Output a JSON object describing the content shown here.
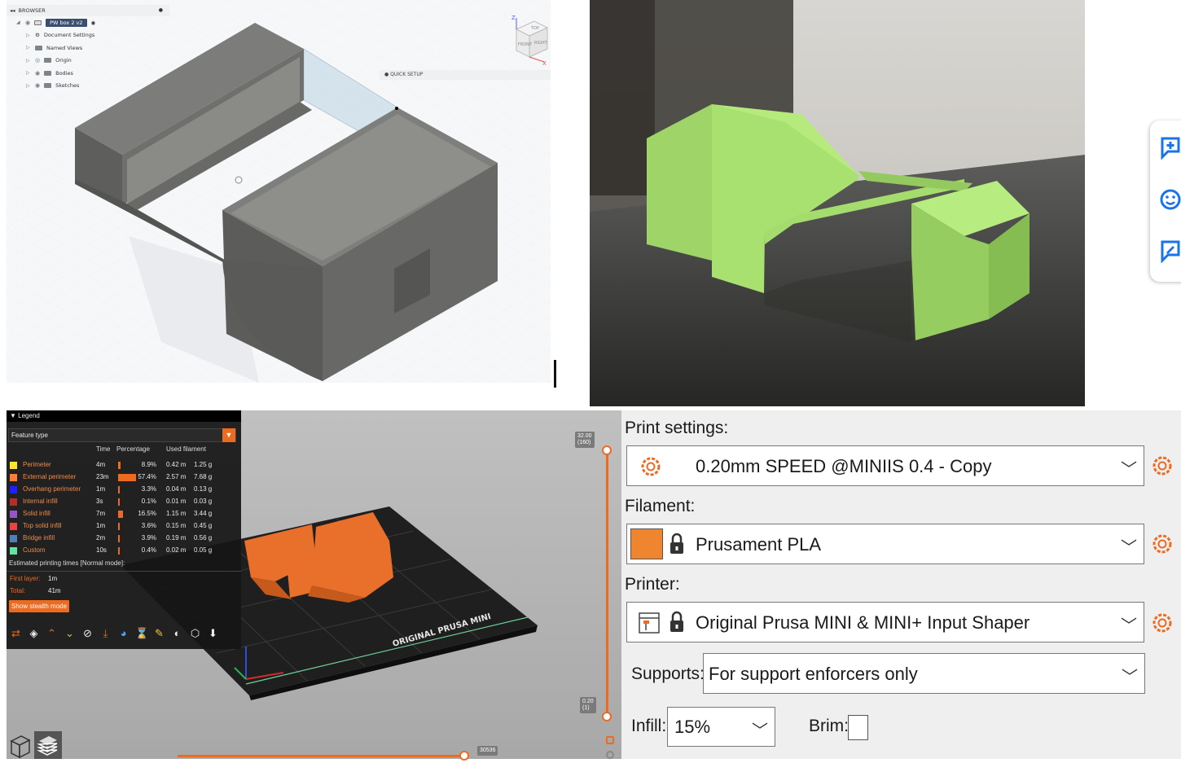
{
  "cad": {
    "browser_label": "BROWSER",
    "tree": [
      {
        "label": "PW box 2 v2"
      },
      {
        "label": "Document Settings"
      },
      {
        "label": "Named Views"
      },
      {
        "label": "Origin"
      },
      {
        "label": "Bodies"
      },
      {
        "label": "Sketches"
      }
    ],
    "quick_setup_label": "QUICK SETUP",
    "viewcube": {
      "face_top": "TOP",
      "face_front": "FRONT",
      "face_right": "RIGHT",
      "axis_z": "Z",
      "axis_x": "X"
    },
    "body_color": "#6e6e6c"
  },
  "photo": {
    "print_color": "#a5e06a"
  },
  "slicer": {
    "legend": {
      "title": "Legend",
      "feature_type": "Feature type",
      "headers": {
        "time": "Time",
        "percentage": "Percentage",
        "used_filament": "Used filament"
      },
      "rows": [
        {
          "name": "Perimeter",
          "color": "#ffe52d",
          "time": "4m",
          "pct": "8.9%",
          "pct_value": 8.9,
          "m": "0.42 m",
          "g": "1.25 g"
        },
        {
          "name": "External perimeter",
          "color": "#ff7d38",
          "time": "23m",
          "pct": "57.4%",
          "pct_value": 57.4,
          "m": "2.57 m",
          "g": "7.68 g"
        },
        {
          "name": "Overhang perimeter",
          "color": "#1f1fff",
          "time": "1m",
          "pct": "3.3%",
          "pct_value": 3.3,
          "m": "0.04 m",
          "g": "0.13 g"
        },
        {
          "name": "Internal infill",
          "color": "#b03029",
          "time": "3s",
          "pct": "0.1%",
          "pct_value": 0.1,
          "m": "0.01 m",
          "g": "0.03 g"
        },
        {
          "name": "Solid infill",
          "color": "#9654cc",
          "time": "7m",
          "pct": "16.5%",
          "pct_value": 16.5,
          "m": "1.15 m",
          "g": "3.44 g"
        },
        {
          "name": "Top solid infill",
          "color": "#f04040",
          "time": "1m",
          "pct": "3.6%",
          "pct_value": 3.6,
          "m": "0.15 m",
          "g": "0.45 g"
        },
        {
          "name": "Bridge infill",
          "color": "#4d80ba",
          "time": "2m",
          "pct": "3.9%",
          "pct_value": 3.9,
          "m": "0.19 m",
          "g": "0.56 g"
        },
        {
          "name": "Custom",
          "color": "#5ee6a0",
          "time": "10s",
          "pct": "0.4%",
          "pct_value": 0.4,
          "m": "0.02 m",
          "g": "0.05 g"
        }
      ],
      "estimated_label": "Estimated printing times [Normal mode]:",
      "first_layer_label": "First layer:",
      "first_layer_value": "1m",
      "total_label": "Total:",
      "total_value": "41m",
      "stealth_button": "Show stealth mode"
    },
    "bed_label": "ORIGINAL PRUSA MINI",
    "layer_top": {
      "height": "32.00",
      "index": "(160)"
    },
    "layer_bottom": {
      "height": "0.20",
      "index": "(1)"
    },
    "horizontal_value": "30536",
    "accent": "#ed6b21"
  },
  "settings": {
    "print_settings_label": "Print settings:",
    "print_profile": "0.20mm SPEED @MINIIS 0.4 - Copy",
    "filament_label": "Filament:",
    "filament": "Prusament PLA",
    "filament_color": "#f08530",
    "printer_label": "Printer:",
    "printer": "Original Prusa MINI & MINI+ Input Shaper",
    "supports_label": "Supports:",
    "supports_value": "For support enforcers only",
    "infill_label": "Infill:",
    "infill_value": "15%",
    "brim_label": "Brim:",
    "brim_checked": false
  }
}
